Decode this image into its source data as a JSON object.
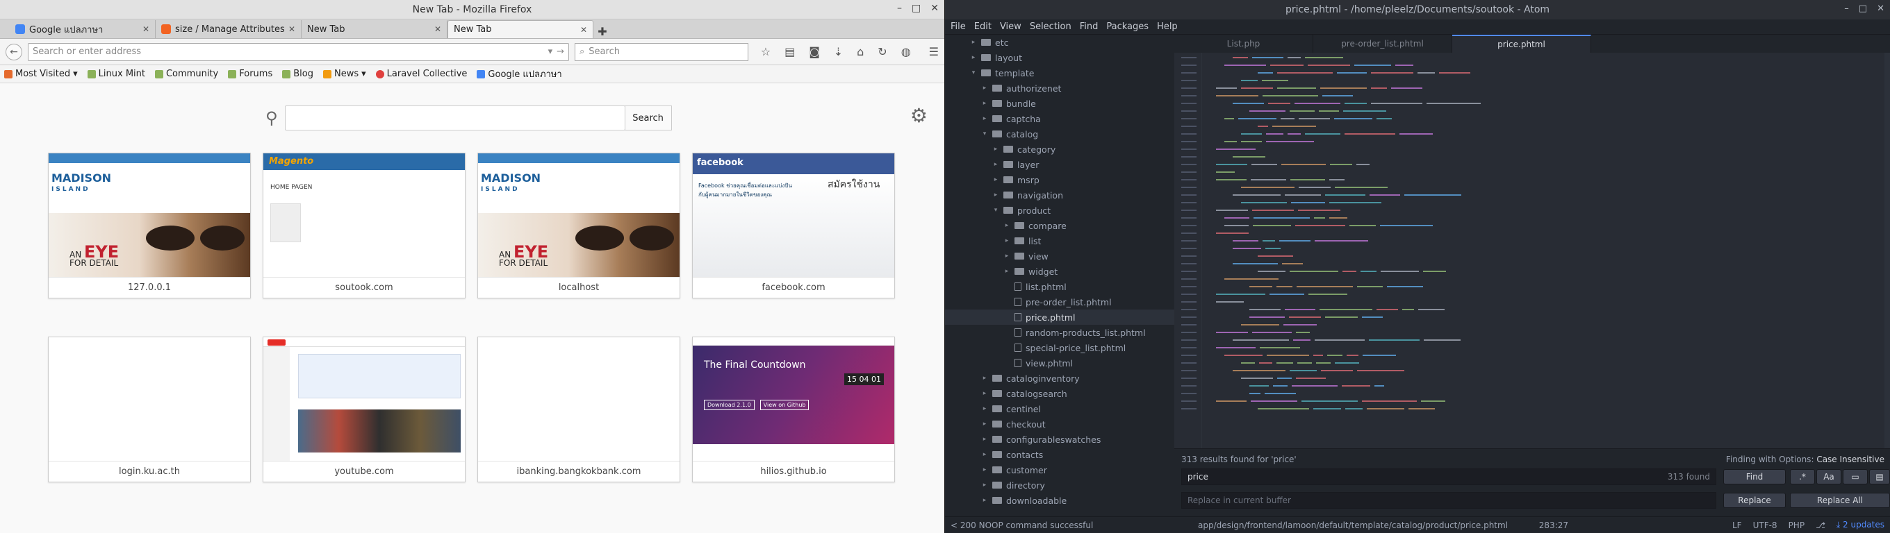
{
  "firefox": {
    "window_title": "New Tab - Mozilla Firefox",
    "tabs": [
      {
        "label": "Google แปลภาษา",
        "favicon_color": "#4285f4"
      },
      {
        "label": "size / Manage Attributes ...",
        "favicon_color": "#f26322"
      },
      {
        "label": "New Tab",
        "favicon_color": ""
      },
      {
        "label": "New Tab",
        "favicon_color": ""
      }
    ],
    "url_placeholder": "Search or enter address",
    "search_placeholder": "Search",
    "bookmarks": [
      {
        "label": "Most Visited",
        "color": "#e56a2c"
      },
      {
        "label": "Linux Mint",
        "color": "#8bb158"
      },
      {
        "label": "Community",
        "color": "#8bb158"
      },
      {
        "label": "Forums",
        "color": "#8bb158"
      },
      {
        "label": "Blog",
        "color": "#8bb158"
      },
      {
        "label": "News",
        "color": "#f29b0f"
      },
      {
        "label": "Laravel Collective",
        "color": "#e0403e"
      },
      {
        "label": "Google แปลภาษา",
        "color": "#4285f4"
      }
    ],
    "ntp": {
      "search_button": "Search",
      "tiles": [
        {
          "caption": "127.0.0.1",
          "kind": "madison"
        },
        {
          "caption": "soutook.com",
          "kind": "magento"
        },
        {
          "caption": "localhost",
          "kind": "madison"
        },
        {
          "caption": "facebook.com",
          "kind": "facebook"
        },
        {
          "caption": "login.ku.ac.th",
          "kind": "blank"
        },
        {
          "caption": "youtube.com",
          "kind": "youtube"
        },
        {
          "caption": "ibanking.bangkokbank.com",
          "kind": "blank"
        },
        {
          "caption": "hilios.github.io",
          "kind": "countdown"
        }
      ],
      "thumb_text": {
        "madison_1": "MADISON",
        "madison_2": "ISLAND",
        "eye_1": "AN",
        "eye_2": "EYE",
        "eye_3": "FOR DETAIL",
        "magento_brand": "Magento",
        "magento_home": "HOME PAGEN",
        "facebook_brand": "facebook",
        "facebook_t1": "Facebook ช่วยคุณเชื่อมต่อและแบ่งปันกับผู้คนมากมายในชีวิตของคุณ",
        "facebook_t2": "สมัครใช้งาน",
        "countdown_title": "The Final Countdown",
        "countdown_clock": "15 04 01",
        "countdown_btn1": "Download 2.1.0",
        "countdown_btn2": "View on Github"
      }
    }
  },
  "atom": {
    "window_title": "price.phtml - /home/pleelz/Documents/soutook - Atom",
    "menu": [
      "File",
      "Edit",
      "View",
      "Selection",
      "Find",
      "Packages",
      "Help"
    ],
    "tree": [
      {
        "label": "etc",
        "depth": 3,
        "type": "dir",
        "open": false
      },
      {
        "label": "layout",
        "depth": 3,
        "type": "dir",
        "open": false
      },
      {
        "label": "template",
        "depth": 3,
        "type": "dir",
        "open": true
      },
      {
        "label": "authorizenet",
        "depth": 4,
        "type": "dir",
        "open": false
      },
      {
        "label": "bundle",
        "depth": 4,
        "type": "dir",
        "open": false
      },
      {
        "label": "captcha",
        "depth": 4,
        "type": "dir",
        "open": false
      },
      {
        "label": "catalog",
        "depth": 4,
        "type": "dir",
        "open": true
      },
      {
        "label": "category",
        "depth": 5,
        "type": "dir",
        "open": false
      },
      {
        "label": "layer",
        "depth": 5,
        "type": "dir",
        "open": false
      },
      {
        "label": "msrp",
        "depth": 5,
        "type": "dir",
        "open": false
      },
      {
        "label": "navigation",
        "depth": 5,
        "type": "dir",
        "open": false
      },
      {
        "label": "product",
        "depth": 5,
        "type": "dir",
        "open": true
      },
      {
        "label": "compare",
        "depth": 6,
        "type": "dir",
        "open": false
      },
      {
        "label": "list",
        "depth": 6,
        "type": "dir",
        "open": false
      },
      {
        "label": "view",
        "depth": 6,
        "type": "dir",
        "open": false
      },
      {
        "label": "widget",
        "depth": 6,
        "type": "dir",
        "open": false
      },
      {
        "label": "list.phtml",
        "depth": 6,
        "type": "file"
      },
      {
        "label": "pre-order_list.phtml",
        "depth": 6,
        "type": "file"
      },
      {
        "label": "price.phtml",
        "depth": 6,
        "type": "file",
        "selected": true
      },
      {
        "label": "random-products_list.phtml",
        "depth": 6,
        "type": "file"
      },
      {
        "label": "special-price_list.phtml",
        "depth": 6,
        "type": "file"
      },
      {
        "label": "view.phtml",
        "depth": 6,
        "type": "file"
      },
      {
        "label": "cataloginventory",
        "depth": 4,
        "type": "dir",
        "open": false
      },
      {
        "label": "catalogsearch",
        "depth": 4,
        "type": "dir",
        "open": false
      },
      {
        "label": "centinel",
        "depth": 4,
        "type": "dir",
        "open": false
      },
      {
        "label": "checkout",
        "depth": 4,
        "type": "dir",
        "open": false
      },
      {
        "label": "configurableswatches",
        "depth": 4,
        "type": "dir",
        "open": false
      },
      {
        "label": "contacts",
        "depth": 4,
        "type": "dir",
        "open": false
      },
      {
        "label": "customer",
        "depth": 4,
        "type": "dir",
        "open": false
      },
      {
        "label": "directory",
        "depth": 4,
        "type": "dir",
        "open": false
      },
      {
        "label": "downloadable",
        "depth": 4,
        "type": "dir",
        "open": false
      }
    ],
    "editor_tabs": [
      {
        "label": "List.php",
        "active": false
      },
      {
        "label": "pre-order_list.phtml",
        "active": false
      },
      {
        "label": "price.phtml",
        "active": true
      }
    ],
    "find": {
      "summary": "313 results found for 'price'",
      "options_label": "Finding with Options:",
      "options_value": "Case Insensitive",
      "query": "price",
      "count": "313 found",
      "replace_placeholder": "Replace in current buffer",
      "find_button": "Find",
      "replace_button": "Replace",
      "replace_all_button": "Replace All"
    },
    "status": {
      "message": "< 200 NOOP command successful",
      "path": "app/design/frontend/lamoon/default/template/catalog/product/price.phtml",
      "cursor": "283:27",
      "line_ending": "LF",
      "encoding": "UTF-8",
      "grammar": "PHP",
      "updates": "2 updates"
    },
    "colors": {
      "bg": "#282c34",
      "panel": "#21252b",
      "accent": "#528bff"
    }
  }
}
